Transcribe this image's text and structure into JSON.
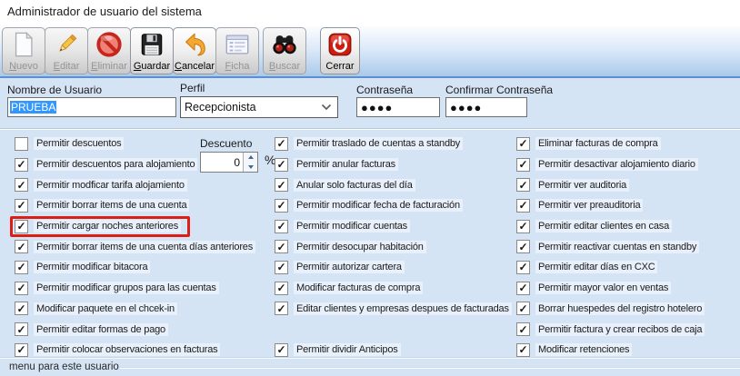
{
  "window": {
    "title": "Administrador de usuario del sistema"
  },
  "toolbar": {
    "buttons": [
      {
        "name": "nuevo",
        "label": "Nuevo",
        "icon": "new-document-icon",
        "enabled": false,
        "underline": 0
      },
      {
        "name": "editar",
        "label": "Editar",
        "icon": "pencil-icon",
        "enabled": false,
        "underline": 0
      },
      {
        "name": "eliminar",
        "label": "Eliminar",
        "icon": "no-circle-icon",
        "enabled": false,
        "underline": 0
      },
      {
        "name": "guardar",
        "label": "Guardar",
        "icon": "floppy-disk-icon",
        "enabled": true,
        "underline": 0
      },
      {
        "name": "cancelar",
        "label": "Cancelar",
        "icon": "undo-arrow-icon",
        "enabled": true,
        "underline": 0
      },
      {
        "name": "ficha",
        "label": "Ficha",
        "icon": "form-window-icon",
        "enabled": false,
        "underline": 0
      },
      {
        "name": "buscar",
        "label": "Buscar",
        "icon": "binoculars-icon",
        "enabled": false,
        "underline": 0
      },
      {
        "name": "cerrar",
        "label": "Cerrar",
        "icon": "power-icon",
        "enabled": true,
        "underline": -1
      }
    ]
  },
  "form": {
    "username": {
      "label": "Nombre de Usuario",
      "value": "PRUEBA"
    },
    "profile": {
      "label": "Perfil",
      "value": "Recepcionista"
    },
    "password": {
      "label": "Contraseña",
      "value": "●●●●"
    },
    "confirm_password": {
      "label": "Confirmar Contraseña",
      "value": "●●●●"
    }
  },
  "discount": {
    "label": "Descuento",
    "value": "0",
    "unit": "%"
  },
  "permissions": {
    "columns": [
      {
        "items": [
          {
            "label": "Permitir descuentos",
            "checked": false
          },
          {
            "label": "Permitir descuentos para alojamiento",
            "checked": true
          },
          {
            "label": "Permitir modficar tarifa alojamiento",
            "checked": true
          },
          {
            "label": "Permitir borrar items de una cuenta",
            "checked": true
          },
          {
            "label": "Permitir cargar noches anteriores",
            "checked": true,
            "highlighted": true
          },
          {
            "label": "Permitir borrar items de una cuenta días anteriores",
            "checked": true
          },
          {
            "label": "Permitir modificar bitacora",
            "checked": true
          },
          {
            "label": "Permitir modificar grupos para las cuentas",
            "checked": true
          },
          {
            "label": "Modificar paquete en el chcek-in",
            "checked": true
          },
          {
            "label": "Permitir editar formas de pago",
            "checked": true
          },
          {
            "label": "Permitir colocar observaciones en facturas",
            "checked": true
          }
        ]
      },
      {
        "items": [
          {
            "label": "Permitir traslado de cuentas a standby",
            "checked": true
          },
          {
            "label": "Permitir anular facturas",
            "checked": true
          },
          {
            "label": "Anular solo facturas del día",
            "checked": true
          },
          {
            "label": "Permitir modificar fecha de facturación",
            "checked": true
          },
          {
            "label": "Permitir modificar cuentas",
            "checked": true
          },
          {
            "label": "Permitir desocupar habitación",
            "checked": true
          },
          {
            "label": "Permitir autorizar cartera",
            "checked": true
          },
          {
            "label": "Modificar facturas de compra",
            "checked": true
          },
          {
            "label": "Editar clientes y empresas despues de facturadas",
            "checked": true
          },
          {
            "spacer": true
          },
          {
            "label": "Permitir dividir Anticipos",
            "checked": true
          }
        ]
      },
      {
        "items": [
          {
            "label": "Eliminar facturas de compra",
            "checked": true
          },
          {
            "label": "Permitir desactivar alojamiento diario",
            "checked": true
          },
          {
            "label": "Permitir ver auditoria",
            "checked": true
          },
          {
            "label": "Permitir ver preauditoria",
            "checked": true
          },
          {
            "label": "Permitir editar clientes en casa",
            "checked": true
          },
          {
            "label": "Permitir reactivar cuentas en standby",
            "checked": true
          },
          {
            "label": "Permitir editar días en CXC",
            "checked": true
          },
          {
            "label": "Permitir mayor valor en ventas",
            "checked": true
          },
          {
            "label": "Borrar huespedes del registro hotelero",
            "checked": true
          },
          {
            "label": "Permitir factura y crear recibos de caja",
            "checked": true
          },
          {
            "label": "Modificar retenciones",
            "checked": true
          }
        ]
      }
    ]
  },
  "footer": {
    "label": "menu para este usuario"
  },
  "colors": {
    "content_background": "#d5e4f4",
    "label_strip": "#e8f1fb",
    "selection_blue": "#3297fd",
    "highlight_red": "#dc1f14",
    "toolbar_line_blue": "#5d8fcf"
  }
}
